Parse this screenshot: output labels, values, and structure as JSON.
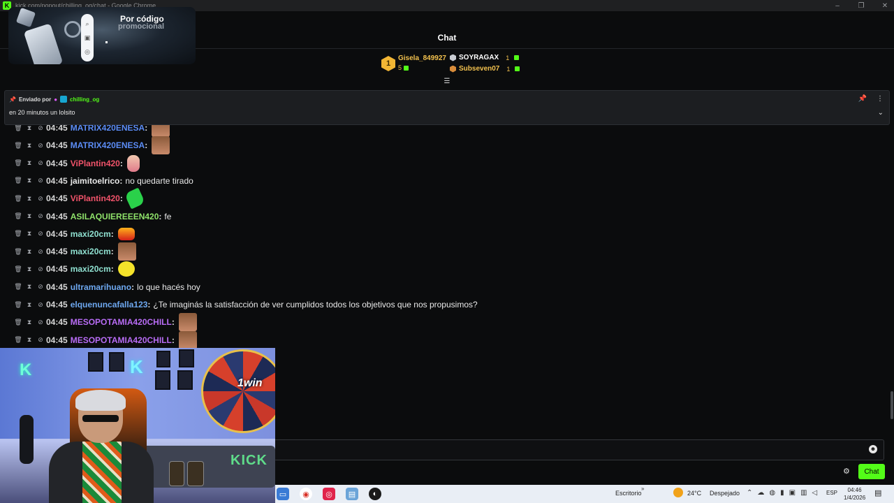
{
  "window": {
    "title": "kick.com/popout/chilling_og/chat - Google Chrome",
    "logo": "K"
  },
  "chat_header": {
    "title": "Chat"
  },
  "leaderboard": {
    "first": {
      "rank": "1",
      "name": "Gisela_849927",
      "count": "5"
    },
    "others": [
      {
        "name": "SOYRAGAX",
        "count": "1",
        "color": "#ffffff",
        "medal": "#c9ccd2"
      },
      {
        "name": "Subseven07",
        "count": "1",
        "color": "#f2c14e",
        "medal": "#d98c3a"
      }
    ]
  },
  "pinned": {
    "sent_by_label": "Enviado por",
    "author": "chilling_og",
    "message": "en 20 minutos un lolsito"
  },
  "messages": [
    {
      "time": "04:45",
      "user": "MATRIX420ENESA",
      "color": "#5b8cf5",
      "text": "",
      "emote": "face-emote"
    },
    {
      "time": "04:45",
      "user": "MATRIX420ENESA",
      "color": "#5b8cf5",
      "text": "",
      "emote": "face-emote"
    },
    {
      "time": "04:45",
      "user": "ViPlantin420",
      "color": "#f0536a",
      "text": "",
      "emote": "hand-emote"
    },
    {
      "time": "04:45",
      "user": "jaimitoelrico",
      "color": "#e9e9e9",
      "text": "no quedarte tirado",
      "emote": ""
    },
    {
      "time": "04:45",
      "user": "ViPlantin420",
      "color": "#f0536a",
      "text": "",
      "emote": "leaf-emote"
    },
    {
      "time": "04:45",
      "user": "ASILAQUIEREEEN420",
      "color": "#8fe26a",
      "text": "fe",
      "emote": ""
    },
    {
      "time": "04:45",
      "user": "maxi20cm",
      "color": "#8fe0d0",
      "text": "",
      "emote": "fire-emote"
    },
    {
      "time": "04:45",
      "user": "maxi20cm",
      "color": "#8fe0d0",
      "text": "",
      "emote": "face-emote"
    },
    {
      "time": "04:45",
      "user": "maxi20cm",
      "color": "#8fe0d0",
      "text": "",
      "emote": "smile-emote"
    },
    {
      "time": "04:45",
      "user": "ultramarihuano",
      "color": "#6ea8f0",
      "text": "lo que hacés hoy",
      "emote": ""
    },
    {
      "time": "04:45",
      "user": "elquenuncafalla123",
      "color": "#6ea8f0",
      "text": "¿Te imaginás la satisfacción de ver cumplidos todos los objetivos que nos propusimos?",
      "emote": ""
    },
    {
      "time": "04:45",
      "user": "MESOPOTAMIA420CHILL",
      "color": "#b86cf5",
      "text": "",
      "emote": "face-emote"
    },
    {
      "time": "04:45",
      "user": "MESOPOTAMIA420CHILL",
      "color": "#b86cf5",
      "text": "",
      "emote": "face-emote"
    }
  ],
  "promo": {
    "line1": "Por código",
    "line2": "promocional"
  },
  "chat_input": {
    "placeholder": "",
    "send_label": "Chat"
  },
  "webcam": {
    "sign_text": "KICK",
    "wheel_text": "1win"
  },
  "taskbar": {
    "desktop_label": "Escritorio",
    "temperature": "24°C",
    "condition": "Despejado",
    "language": "ESP",
    "time": "04:46",
    "date": "1/4/2026"
  }
}
